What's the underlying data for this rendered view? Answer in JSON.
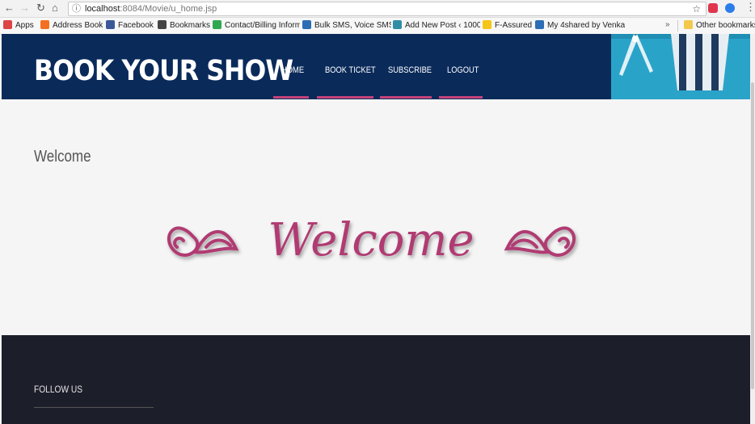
{
  "browser": {
    "url_host": "localhost",
    "url_path": ":8084/Movie/u_home.jsp",
    "bookmarks": [
      {
        "label": "Apps",
        "color": "#d44"
      },
      {
        "label": "Address Book",
        "color": "#f36f21"
      },
      {
        "label": "Facebook",
        "color": "#3b5998"
      },
      {
        "label": "Bookmarks",
        "color": "#444"
      },
      {
        "label": "Contact/Billing Inform",
        "color": "#2fa84f"
      },
      {
        "label": "Bulk SMS, Voice SMS",
        "color": "#2d6db5"
      },
      {
        "label": "Add New Post ‹ 1000",
        "color": "#2f8ea6"
      },
      {
        "label": "F-Assured",
        "color": "#f5c518"
      },
      {
        "label": "My 4shared by Venka",
        "color": "#2d6db5"
      }
    ],
    "other_bookmarks": "Other bookmarks",
    "more": "»"
  },
  "header": {
    "brand": "BOOK YOUR SHOW",
    "menu": [
      "HOME",
      "BOOK TICKET",
      "SUBSCRIBE",
      "LOGOUT"
    ]
  },
  "main": {
    "welcome_heading": "Welcome",
    "welcome_art_text": "Welcome",
    "accent_color": "#b03a72"
  },
  "footer": {
    "follow_us": "FOLLOW US"
  }
}
